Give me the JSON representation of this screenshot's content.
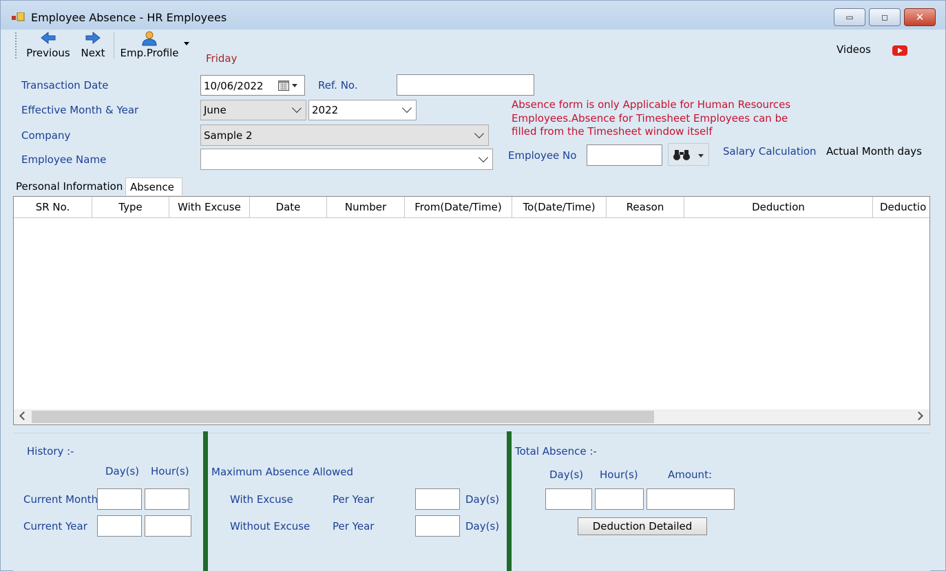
{
  "window": {
    "title": "Employee Absence - HR Employees",
    "controls": {
      "minimize": "▭",
      "restore": "◻",
      "close": "✕"
    }
  },
  "toolbar": {
    "previous_label": "Previous",
    "next_label": "Next",
    "emp_profile_label": "Emp.Profile",
    "videos_label": "Videos"
  },
  "day_of_week": "Friday",
  "form": {
    "transaction_date_label": "Transaction Date",
    "transaction_date_value": "10/06/2022",
    "ref_no_label": "Ref. No.",
    "ref_no_value": "",
    "effective_label": "Effective Month & Year",
    "month_value": "June",
    "year_value": "2022",
    "company_label": "Company",
    "company_value": "Sample 2",
    "employee_name_label": "Employee Name",
    "employee_name_value": "",
    "employee_no_label": "Employee No",
    "employee_no_value": "",
    "salary_calc_label": "Salary Calculation",
    "salary_calc_value": "Actual Month days",
    "notice_line1": "Absence form is only Applicable for Human Resources",
    "notice_line2": "Employees.Absence for Timesheet Employees can be",
    "notice_line3": "filled from the Timesheet window itself"
  },
  "tabs": [
    {
      "label": "Personal Information",
      "active": false
    },
    {
      "label": "Absence",
      "active": true
    }
  ],
  "grid": {
    "columns": [
      "SR No.",
      "Type",
      "With Excuse",
      "Date",
      "Number",
      "From(Date/Time)",
      "To(Date/Time)",
      "Reason",
      "Deduction",
      "Deductio"
    ],
    "rows": []
  },
  "history": {
    "title": "History :-",
    "day_header": "Day(s)",
    "hour_header": "Hour(s)",
    "current_month_label": "Current Month",
    "current_year_label": "Current Year"
  },
  "max_absence": {
    "title": "Maximum Absence Allowed",
    "with_excuse_label": "With Excuse",
    "without_excuse_label": "Without Excuse",
    "per_year_label": "Per Year",
    "days_label": "Day(s)"
  },
  "total_absence": {
    "title": "Total Absence :-",
    "day_header": "Day(s)",
    "hour_header": "Hour(s)",
    "amount_header": "Amount:",
    "deduction_button": "Deduction Detailed"
  },
  "colors": {
    "label_blue": "#1c3f94",
    "notice_red": "#c8102e",
    "divider_green": "#1f6b2a",
    "window_bg": "#dce9f3"
  },
  "icons": {
    "previous": "arrow-left-icon",
    "next": "arrow-right-icon",
    "emp_profile": "user-icon",
    "videos": "youtube-icon",
    "calendar": "calendar-icon",
    "search": "binoculars-icon"
  }
}
